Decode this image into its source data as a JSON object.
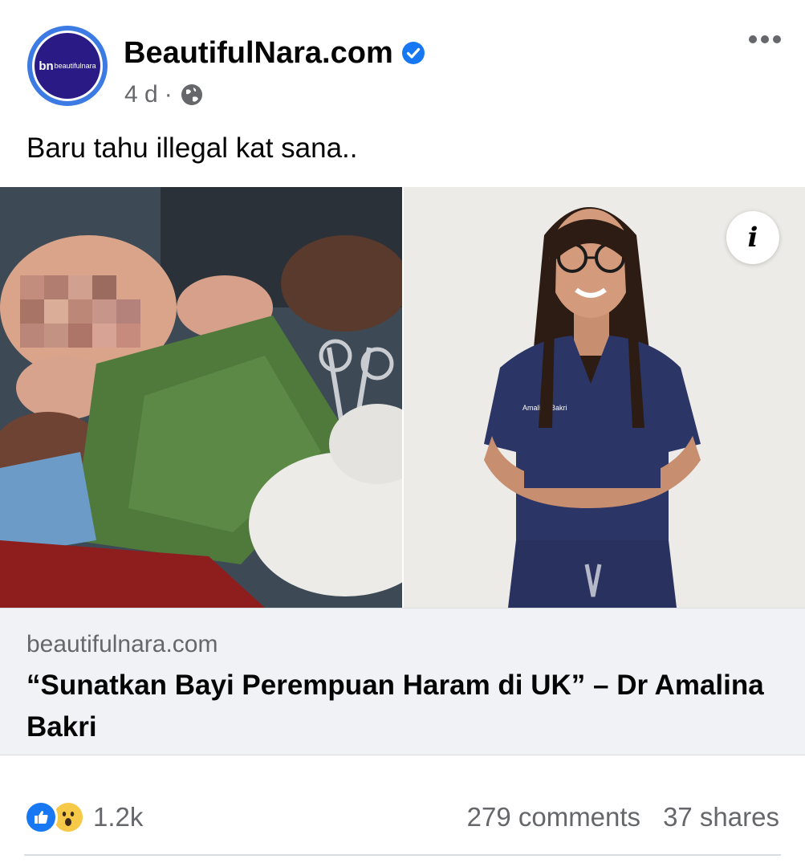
{
  "post": {
    "page_name": "BeautifulNara.com",
    "avatar_text": "beautifulnara",
    "avatar_initials": "bn",
    "time": "4 d",
    "separator": "·",
    "caption": "Baru tahu illegal kat sana..",
    "verified": true
  },
  "media": {
    "right_photo_scrub_text": "Amalina Bakri"
  },
  "link": {
    "domain": "beautifulnara.com",
    "title": "“Sunatkan Bayi Perempuan Haram di UK” – Dr Amalina Bakri"
  },
  "engagement": {
    "reaction_count": "1.2k",
    "reactions": [
      "like-icon",
      "wow-icon"
    ],
    "comments": "279 comments",
    "shares": "37 shares"
  },
  "colors": {
    "accent": "#1877f2",
    "secondary_text": "#65676b",
    "link_bg": "#f0f2f5"
  }
}
